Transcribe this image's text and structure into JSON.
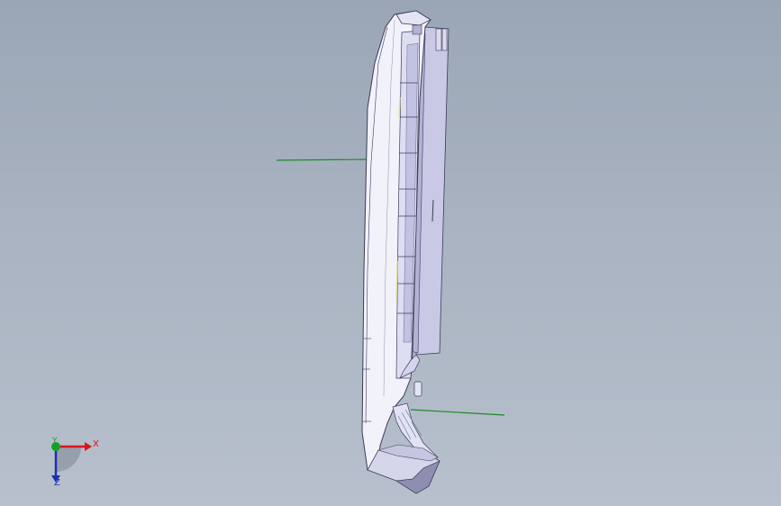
{
  "viewport": {
    "background_top": "#9aa6b6",
    "background_bottom": "#b7c0cc"
  },
  "model": {
    "body_color": "#f2f2fa",
    "outline_color": "#3c3c5a",
    "panel_color": "#c9c9e6",
    "shade_color": "#8e8eb0",
    "highlight_color": "#e6e0a0",
    "dimension_line_color": "#1e8a2a"
  },
  "triad": {
    "x_label": "X",
    "y_label": "Y",
    "z_label": "Z",
    "x_color": "#d8161a",
    "y_color": "#16a02a",
    "z_color": "#1d2fb5"
  }
}
